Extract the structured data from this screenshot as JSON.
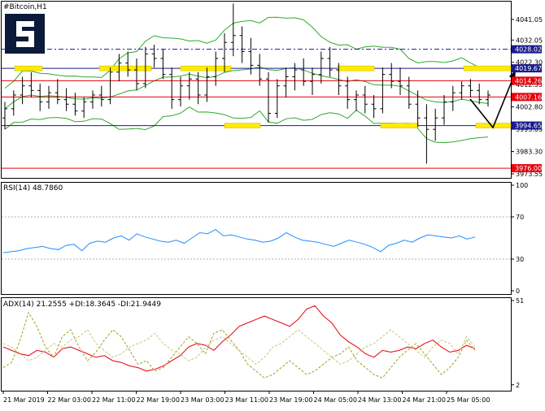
{
  "chart_data": [
    {
      "type": "candlestick",
      "title": "#Bitcoin,H1",
      "ylim": [
        3973.55,
        4046.0
      ],
      "grid": false,
      "y_ticks": [
        "4041.05",
        "4032.05",
        "4022.30",
        "4012.55",
        "4002.80",
        "3993.05",
        "3983.30",
        "3973.55"
      ],
      "price_tags": [
        {
          "label": "4028.02",
          "value": 4028.02,
          "color": "#1a1a8c",
          "style": "dashdot"
        },
        {
          "label": "4019.67",
          "value": 4019.67,
          "color": "#1a1a8c",
          "style": "solid"
        },
        {
          "label": "4014.26",
          "value": 4014.26,
          "color": "#e8000b",
          "style": "solid"
        },
        {
          "label": "4007.16",
          "value": 4007.16,
          "color": "#e8000b",
          "style": "solid"
        },
        {
          "label": "3994.65",
          "value": 3994.65,
          "color": "#1a1a8c",
          "style": "solid"
        },
        {
          "label": "3976.00",
          "value": 3976.0,
          "color": "#e8000b",
          "style": "solid"
        }
      ],
      "colors": {
        "candle": "#000000",
        "bollinger": "#2eaa2e",
        "support": "#e8000b",
        "resistance": "#1a1a8c",
        "zone": "#ffeb00"
      },
      "candles_ohlc": [
        [
          3998,
          4005,
          3993,
          4002
        ],
        [
          4002,
          4010,
          3999,
          4008
        ],
        [
          4008,
          4016,
          4004,
          4012
        ],
        [
          4012,
          4018,
          4007,
          4010
        ],
        [
          4010,
          4013,
          4001,
          4005
        ],
        [
          4005,
          4012,
          4002,
          4009
        ],
        [
          4009,
          4015,
          4004,
          4006
        ],
        [
          4006,
          4011,
          4001,
          4004
        ],
        [
          4004,
          4009,
          3999,
          4001
        ],
        [
          4001,
          4007,
          3998,
          4005
        ],
        [
          4005,
          4010,
          4002,
          4008
        ],
        [
          4008,
          4012,
          4003,
          4006
        ],
        [
          4006,
          4020,
          4004,
          4018
        ],
        [
          4018,
          4026,
          4014,
          4022
        ],
        [
          4022,
          4027,
          4016,
          4019
        ],
        [
          4019,
          4024,
          4010,
          4013
        ],
        [
          4013,
          4029,
          4011,
          4026
        ],
        [
          4026,
          4030,
          4020,
          4024
        ],
        [
          4024,
          4028,
          4015,
          4017
        ],
        [
          4017,
          4020,
          4002,
          4006
        ],
        [
          4006,
          4016,
          4003,
          4012
        ],
        [
          4012,
          4018,
          4006,
          4015
        ],
        [
          4015,
          4018,
          4004,
          4008
        ],
        [
          4008,
          4020,
          4005,
          4016
        ],
        [
          4016,
          4027,
          4012,
          4024
        ],
        [
          4024,
          4035,
          4018,
          4031
        ],
        [
          4031,
          4048,
          4025,
          4034
        ],
        [
          4034,
          4038,
          4022,
          4027
        ],
        [
          4027,
          4033,
          4017,
          4021
        ],
        [
          4021,
          4026,
          4012,
          4015
        ],
        [
          4015,
          4018,
          3996,
          4000
        ],
        [
          4000,
          4015,
          3998,
          4012
        ],
        [
          4012,
          4020,
          4007,
          4016
        ],
        [
          4016,
          4022,
          4010,
          4019
        ],
        [
          4019,
          4024,
          4012,
          4014
        ],
        [
          4014,
          4020,
          4008,
          4017
        ],
        [
          4017,
          4027,
          4013,
          4024
        ],
        [
          4024,
          4029,
          4016,
          4019
        ],
        [
          4019,
          4022,
          4008,
          4012
        ],
        [
          4012,
          4016,
          4002,
          4006
        ],
        [
          4006,
          4010,
          4001,
          4008
        ],
        [
          4008,
          4012,
          4000,
          4004
        ],
        [
          4004,
          4008,
          3998,
          4002
        ],
        [
          4002,
          4020,
          4000,
          4017
        ],
        [
          4017,
          4022,
          4011,
          4014
        ],
        [
          4014,
          4020,
          4008,
          4012
        ],
        [
          4012,
          4016,
          4002,
          4004
        ],
        [
          4004,
          4010,
          3994,
          3998
        ],
        [
          3998,
          4004,
          3978,
          3993
        ],
        [
          3993,
          4002,
          3988,
          3998
        ],
        [
          3998,
          4008,
          3995,
          4005
        ],
        [
          4005,
          4012,
          4001,
          4009
        ],
        [
          4009,
          4014,
          4006,
          4012
        ],
        [
          4012,
          4015,
          4007,
          4010
        ],
        [
          4010,
          4013,
          4004,
          4006
        ],
        [
          4006,
          4010,
          4003,
          4008
        ]
      ]
    },
    {
      "type": "line",
      "title": "RSI(14) 48.7860",
      "ylim": [
        0,
        100
      ],
      "y_ticks": [
        "100",
        "70",
        "30",
        "0"
      ],
      "levels": [
        70,
        30
      ],
      "series": [
        {
          "color": "#1e90ff",
          "values": [
            36,
            37,
            38,
            40,
            41,
            42,
            40,
            39,
            43,
            44,
            38,
            45,
            47,
            46,
            50,
            52,
            48,
            54,
            51,
            49,
            47,
            46,
            48,
            45,
            50,
            55,
            54,
            58,
            52,
            53,
            51,
            49,
            48,
            46,
            47,
            50,
            55,
            51,
            48,
            47,
            46,
            44,
            42,
            45,
            48,
            46,
            44,
            41,
            37,
            43,
            45,
            48,
            46,
            50,
            53,
            52,
            51,
            50,
            52,
            49,
            51
          ]
        }
      ]
    },
    {
      "type": "line",
      "title": "ADX(14) 21.2555 +DI:18.3645 -DI:21.9449",
      "ylim": [
        0,
        51
      ],
      "y_ticks": [
        "51",
        "2"
      ],
      "x_ticks": [
        "21 Mar 2019",
        "22 Mar 03:00",
        "22 Mar 11:00",
        "22 Mar 19:00",
        "23 Mar 03:00",
        "23 Mar 11:00",
        "23 Mar 19:00",
        "24 Mar 05:00",
        "24 Mar 13:00",
        "24 Mar 21:00",
        "25 Mar 05:00"
      ],
      "series": [
        {
          "color": "#e8000b",
          "values": [
            24,
            22,
            20,
            19,
            22,
            21,
            18,
            23,
            24,
            22,
            20,
            18,
            19,
            16,
            15,
            13,
            12,
            10,
            11,
            13,
            16,
            19,
            24,
            26,
            25,
            22,
            27,
            31,
            36,
            38,
            40,
            42,
            40,
            38,
            36,
            40,
            46,
            48,
            42,
            38,
            31,
            27,
            24,
            20,
            18,
            22,
            21,
            22,
            24,
            23,
            26,
            28,
            24,
            21,
            22,
            25,
            23
          ]
        },
        {
          "color": "#a0a020",
          "values": [
            12,
            15,
            28,
            44,
            36,
            24,
            18,
            30,
            34,
            24,
            16,
            21,
            28,
            34,
            30,
            22,
            14,
            16,
            10,
            12,
            18,
            24,
            30,
            26,
            20,
            32,
            34,
            28,
            22,
            14,
            10,
            6,
            8,
            12,
            16,
            12,
            8,
            10,
            14,
            18,
            20,
            24,
            16,
            12,
            8,
            6,
            12,
            18,
            22,
            26,
            20,
            14,
            8,
            12,
            18,
            28,
            22
          ]
        },
        {
          "color": "#c5c870",
          "values": [
            26,
            24,
            20,
            16,
            18,
            22,
            26,
            24,
            28,
            30,
            34,
            26,
            22,
            18,
            20,
            24,
            26,
            28,
            32,
            26,
            22,
            20,
            16,
            18,
            24,
            28,
            30,
            26,
            22,
            18,
            14,
            18,
            24,
            26,
            30,
            34,
            30,
            26,
            22,
            18,
            14,
            16,
            20,
            24,
            26,
            30,
            34,
            30,
            26,
            22,
            18,
            24,
            28,
            26,
            20,
            30,
            24
          ]
        }
      ]
    }
  ]
}
